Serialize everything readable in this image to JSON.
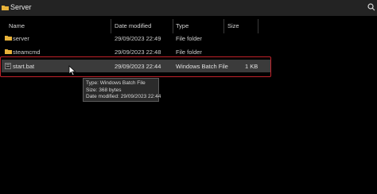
{
  "window": {
    "title": "Server"
  },
  "colors": {
    "background": "#000000",
    "top_bar": "#232323",
    "selected_row": "#3b3b3b",
    "folder_yellow": "#e8b23a",
    "highlight_red": "#c0222a",
    "tooltip_bg": "#2b2b2b"
  },
  "columns": {
    "name": "Name",
    "date_modified": "Date modified",
    "type": "Type",
    "size": "Size"
  },
  "files": [
    {
      "name": "server",
      "date": "29/09/2023 22:49",
      "type": "File folder",
      "size": "",
      "icon": "folder-icon"
    },
    {
      "name": "steamcmd",
      "date": "29/09/2023 22:48",
      "type": "File folder",
      "size": "",
      "icon": "folder-icon"
    },
    {
      "name": "start.bat",
      "date": "29/09/2023 22:44",
      "type": "Windows Batch File",
      "size": "1 KB",
      "icon": "batch-file-icon",
      "selected": true
    }
  ],
  "tooltip": {
    "type_line": "Type: Windows Batch File",
    "size_line": "Size: 368 bytes",
    "date_line": "Date modified: 29/09/2023 22:44"
  }
}
